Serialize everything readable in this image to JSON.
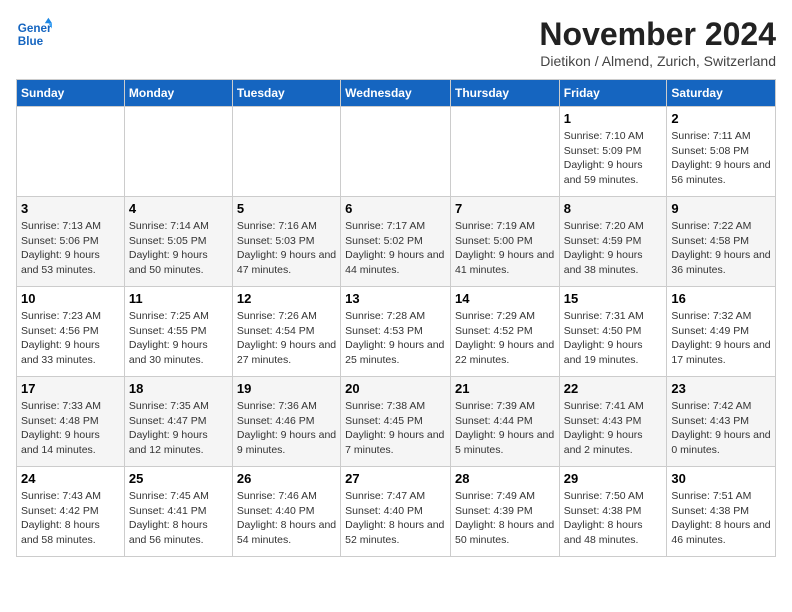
{
  "logo": {
    "line1": "General",
    "line2": "Blue"
  },
  "title": "November 2024",
  "subtitle": "Dietikon / Almend, Zurich, Switzerland",
  "weekdays": [
    "Sunday",
    "Monday",
    "Tuesday",
    "Wednesday",
    "Thursday",
    "Friday",
    "Saturday"
  ],
  "weeks": [
    [
      {
        "day": "",
        "info": ""
      },
      {
        "day": "",
        "info": ""
      },
      {
        "day": "",
        "info": ""
      },
      {
        "day": "",
        "info": ""
      },
      {
        "day": "",
        "info": ""
      },
      {
        "day": "1",
        "info": "Sunrise: 7:10 AM\nSunset: 5:09 PM\nDaylight: 9 hours and 59 minutes."
      },
      {
        "day": "2",
        "info": "Sunrise: 7:11 AM\nSunset: 5:08 PM\nDaylight: 9 hours and 56 minutes."
      }
    ],
    [
      {
        "day": "3",
        "info": "Sunrise: 7:13 AM\nSunset: 5:06 PM\nDaylight: 9 hours and 53 minutes."
      },
      {
        "day": "4",
        "info": "Sunrise: 7:14 AM\nSunset: 5:05 PM\nDaylight: 9 hours and 50 minutes."
      },
      {
        "day": "5",
        "info": "Sunrise: 7:16 AM\nSunset: 5:03 PM\nDaylight: 9 hours and 47 minutes."
      },
      {
        "day": "6",
        "info": "Sunrise: 7:17 AM\nSunset: 5:02 PM\nDaylight: 9 hours and 44 minutes."
      },
      {
        "day": "7",
        "info": "Sunrise: 7:19 AM\nSunset: 5:00 PM\nDaylight: 9 hours and 41 minutes."
      },
      {
        "day": "8",
        "info": "Sunrise: 7:20 AM\nSunset: 4:59 PM\nDaylight: 9 hours and 38 minutes."
      },
      {
        "day": "9",
        "info": "Sunrise: 7:22 AM\nSunset: 4:58 PM\nDaylight: 9 hours and 36 minutes."
      }
    ],
    [
      {
        "day": "10",
        "info": "Sunrise: 7:23 AM\nSunset: 4:56 PM\nDaylight: 9 hours and 33 minutes."
      },
      {
        "day": "11",
        "info": "Sunrise: 7:25 AM\nSunset: 4:55 PM\nDaylight: 9 hours and 30 minutes."
      },
      {
        "day": "12",
        "info": "Sunrise: 7:26 AM\nSunset: 4:54 PM\nDaylight: 9 hours and 27 minutes."
      },
      {
        "day": "13",
        "info": "Sunrise: 7:28 AM\nSunset: 4:53 PM\nDaylight: 9 hours and 25 minutes."
      },
      {
        "day": "14",
        "info": "Sunrise: 7:29 AM\nSunset: 4:52 PM\nDaylight: 9 hours and 22 minutes."
      },
      {
        "day": "15",
        "info": "Sunrise: 7:31 AM\nSunset: 4:50 PM\nDaylight: 9 hours and 19 minutes."
      },
      {
        "day": "16",
        "info": "Sunrise: 7:32 AM\nSunset: 4:49 PM\nDaylight: 9 hours and 17 minutes."
      }
    ],
    [
      {
        "day": "17",
        "info": "Sunrise: 7:33 AM\nSunset: 4:48 PM\nDaylight: 9 hours and 14 minutes."
      },
      {
        "day": "18",
        "info": "Sunrise: 7:35 AM\nSunset: 4:47 PM\nDaylight: 9 hours and 12 minutes."
      },
      {
        "day": "19",
        "info": "Sunrise: 7:36 AM\nSunset: 4:46 PM\nDaylight: 9 hours and 9 minutes."
      },
      {
        "day": "20",
        "info": "Sunrise: 7:38 AM\nSunset: 4:45 PM\nDaylight: 9 hours and 7 minutes."
      },
      {
        "day": "21",
        "info": "Sunrise: 7:39 AM\nSunset: 4:44 PM\nDaylight: 9 hours and 5 minutes."
      },
      {
        "day": "22",
        "info": "Sunrise: 7:41 AM\nSunset: 4:43 PM\nDaylight: 9 hours and 2 minutes."
      },
      {
        "day": "23",
        "info": "Sunrise: 7:42 AM\nSunset: 4:43 PM\nDaylight: 9 hours and 0 minutes."
      }
    ],
    [
      {
        "day": "24",
        "info": "Sunrise: 7:43 AM\nSunset: 4:42 PM\nDaylight: 8 hours and 58 minutes."
      },
      {
        "day": "25",
        "info": "Sunrise: 7:45 AM\nSunset: 4:41 PM\nDaylight: 8 hours and 56 minutes."
      },
      {
        "day": "26",
        "info": "Sunrise: 7:46 AM\nSunset: 4:40 PM\nDaylight: 8 hours and 54 minutes."
      },
      {
        "day": "27",
        "info": "Sunrise: 7:47 AM\nSunset: 4:40 PM\nDaylight: 8 hours and 52 minutes."
      },
      {
        "day": "28",
        "info": "Sunrise: 7:49 AM\nSunset: 4:39 PM\nDaylight: 8 hours and 50 minutes."
      },
      {
        "day": "29",
        "info": "Sunrise: 7:50 AM\nSunset: 4:38 PM\nDaylight: 8 hours and 48 minutes."
      },
      {
        "day": "30",
        "info": "Sunrise: 7:51 AM\nSunset: 4:38 PM\nDaylight: 8 hours and 46 minutes."
      }
    ]
  ]
}
